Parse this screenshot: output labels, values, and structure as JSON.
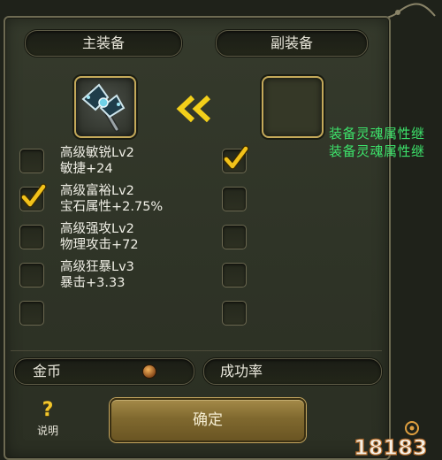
{
  "tabs": {
    "main_equipment": "主装备",
    "sub_equipment": "副装备"
  },
  "main_slot": {
    "item_icon": "double-axe-icon",
    "filled": true
  },
  "sub_slot": {
    "filled": false
  },
  "transfer_icon": "double-chevron-left-icon",
  "side_notes": [
    "装备灵魂属性继",
    "装备灵魂属性继"
  ],
  "options": [
    {
      "line1": "高级敏锐Lv2",
      "line2": "敏捷+24",
      "main_checked": false,
      "sub_checked": true
    },
    {
      "line1": "高级富裕Lv2",
      "line2": "宝石属性+2.75%",
      "main_checked": true,
      "sub_checked": false
    },
    {
      "line1": "高级强攻Lv2",
      "line2": "物理攻击+72",
      "main_checked": false,
      "sub_checked": false
    },
    {
      "line1": "高级狂暴Lv3",
      "line2": "暴击+3.33",
      "main_checked": false,
      "sub_checked": false
    },
    {
      "line1": "",
      "line2": "",
      "main_checked": false,
      "sub_checked": false
    }
  ],
  "gold": {
    "label": "金币",
    "icon": "coin-icon"
  },
  "success_rate": {
    "label": "成功率"
  },
  "help": {
    "symbol": "?",
    "label": "说明"
  },
  "confirm_label": "确定",
  "watermark": "18183",
  "colors": {
    "accent_gold": "#c4a95a",
    "check_yellow": "#f2c21a",
    "note_green": "#3de36b"
  }
}
